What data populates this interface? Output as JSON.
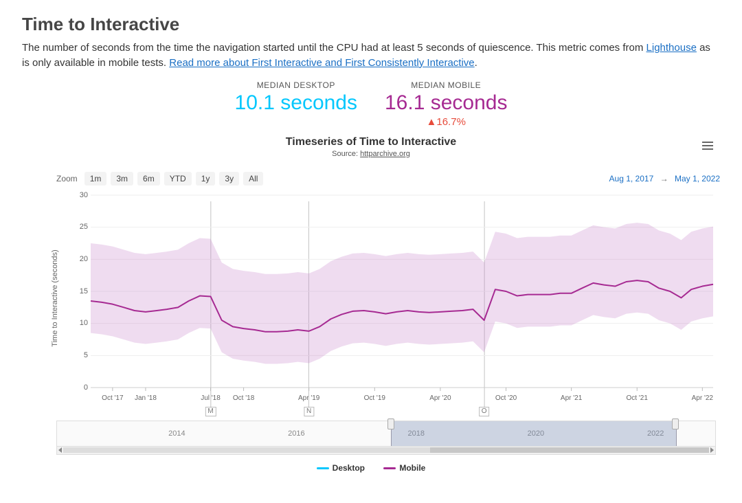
{
  "title": "Time to Interactive",
  "description": {
    "text1": "The number of seconds from the time the navigation started until the CPU had at least 5 seconds of quiescence. This metric comes from ",
    "link1": "Lighthouse",
    "text2": " as is only available in mobile tests. ",
    "link2": "Read more about First Interactive and First Consistently Interactive",
    "text3": "."
  },
  "metrics": {
    "desktop": {
      "label": "MEDIAN DESKTOP",
      "value": "10.1 seconds"
    },
    "mobile": {
      "label": "MEDIAN MOBILE",
      "value": "16.1 seconds",
      "delta": "▲16.7%"
    }
  },
  "chart": {
    "title": "Timeseries of Time to Interactive",
    "source_prefix": "Source: ",
    "source": "httparchive.org",
    "ylabel": "Time to Interactive (seconds)"
  },
  "zoom": {
    "label": "Zoom",
    "buttons": [
      "1m",
      "3m",
      "6m",
      "YTD",
      "1y",
      "3y",
      "All"
    ]
  },
  "date_range": {
    "from": "Aug 1, 2017",
    "to": "May 1, 2022",
    "arrow": "→"
  },
  "x_ticks": [
    "Oct '17",
    "Jan '18",
    "Jul '18",
    "Oct '18",
    "Apr '19",
    "Oct '19",
    "Apr '20",
    "Oct '20",
    "Apr '21",
    "Oct '21",
    "Apr '22"
  ],
  "y_ticks": [
    "0",
    "5",
    "10",
    "15",
    "20",
    "25",
    "30"
  ],
  "flags": [
    "M",
    "N",
    "O"
  ],
  "navigator_years": [
    "2014",
    "2016",
    "2018",
    "2020",
    "2022"
  ],
  "legend": [
    {
      "name": "Desktop",
      "color": "#04c7fd"
    },
    {
      "name": "Mobile",
      "color": "#a62a92"
    }
  ],
  "chart_data": {
    "type": "line",
    "title": "Timeseries of Time to Interactive",
    "xlabel": "",
    "ylabel": "Time to Interactive (seconds)",
    "ylim": [
      0,
      30
    ],
    "x_range": [
      "2017-08-01",
      "2022-05-01"
    ],
    "series": [
      {
        "name": "Mobile",
        "color": "#a62a92",
        "points": [
          {
            "x": "2017-08-01",
            "y": 13.5
          },
          {
            "x": "2017-09-01",
            "y": 13.3
          },
          {
            "x": "2017-10-01",
            "y": 13.0
          },
          {
            "x": "2017-11-01",
            "y": 12.5
          },
          {
            "x": "2017-12-01",
            "y": 12.0
          },
          {
            "x": "2018-01-01",
            "y": 11.8
          },
          {
            "x": "2018-02-01",
            "y": 12.0
          },
          {
            "x": "2018-03-01",
            "y": 12.2
          },
          {
            "x": "2018-04-01",
            "y": 12.5
          },
          {
            "x": "2018-05-01",
            "y": 13.5
          },
          {
            "x": "2018-06-01",
            "y": 14.3
          },
          {
            "x": "2018-07-01",
            "y": 14.2
          },
          {
            "x": "2018-08-01",
            "y": 10.5
          },
          {
            "x": "2018-09-01",
            "y": 9.5
          },
          {
            "x": "2018-10-01",
            "y": 9.2
          },
          {
            "x": "2018-11-01",
            "y": 9.0
          },
          {
            "x": "2018-12-01",
            "y": 8.7
          },
          {
            "x": "2019-01-01",
            "y": 8.7
          },
          {
            "x": "2019-02-01",
            "y": 8.8
          },
          {
            "x": "2019-03-01",
            "y": 9.0
          },
          {
            "x": "2019-04-01",
            "y": 8.8
          },
          {
            "x": "2019-05-01",
            "y": 9.5
          },
          {
            "x": "2019-06-01",
            "y": 10.7
          },
          {
            "x": "2019-07-01",
            "y": 11.4
          },
          {
            "x": "2019-08-01",
            "y": 11.9
          },
          {
            "x": "2019-09-01",
            "y": 12.0
          },
          {
            "x": "2019-10-01",
            "y": 11.8
          },
          {
            "x": "2019-11-01",
            "y": 11.5
          },
          {
            "x": "2019-12-01",
            "y": 11.8
          },
          {
            "x": "2020-01-01",
            "y": 12.0
          },
          {
            "x": "2020-02-01",
            "y": 11.8
          },
          {
            "x": "2020-03-01",
            "y": 11.7
          },
          {
            "x": "2020-04-01",
            "y": 11.8
          },
          {
            "x": "2020-05-01",
            "y": 11.9
          },
          {
            "x": "2020-06-01",
            "y": 12.0
          },
          {
            "x": "2020-07-01",
            "y": 12.2
          },
          {
            "x": "2020-08-01",
            "y": 10.5
          },
          {
            "x": "2020-09-01",
            "y": 15.3
          },
          {
            "x": "2020-10-01",
            "y": 15.0
          },
          {
            "x": "2020-11-01",
            "y": 14.3
          },
          {
            "x": "2020-12-01",
            "y": 14.5
          },
          {
            "x": "2021-01-01",
            "y": 14.5
          },
          {
            "x": "2021-02-01",
            "y": 14.5
          },
          {
            "x": "2021-03-01",
            "y": 14.7
          },
          {
            "x": "2021-04-01",
            "y": 14.7
          },
          {
            "x": "2021-05-01",
            "y": 15.5
          },
          {
            "x": "2021-06-01",
            "y": 16.3
          },
          {
            "x": "2021-07-01",
            "y": 16.0
          },
          {
            "x": "2021-08-01",
            "y": 15.8
          },
          {
            "x": "2021-09-01",
            "y": 16.5
          },
          {
            "x": "2021-10-01",
            "y": 16.7
          },
          {
            "x": "2021-11-01",
            "y": 16.5
          },
          {
            "x": "2021-12-01",
            "y": 15.5
          },
          {
            "x": "2022-01-01",
            "y": 15.0
          },
          {
            "x": "2022-02-01",
            "y": 14.0
          },
          {
            "x": "2022-03-01",
            "y": 15.3
          },
          {
            "x": "2022-04-01",
            "y": 15.8
          },
          {
            "x": "2022-05-01",
            "y": 16.1
          }
        ],
        "band_low_offset": -5,
        "band_high_offset": 9
      }
    ],
    "flags": [
      {
        "label": "M",
        "x": "2018-07-01"
      },
      {
        "label": "N",
        "x": "2019-04-01"
      },
      {
        "label": "O",
        "x": "2020-08-01"
      }
    ],
    "navigator": {
      "full_range": [
        "2012-01-01",
        "2022-12-31"
      ],
      "selected": [
        "2017-08-01",
        "2022-05-01"
      ],
      "year_ticks": [
        2014,
        2016,
        2018,
        2020,
        2022
      ]
    }
  }
}
